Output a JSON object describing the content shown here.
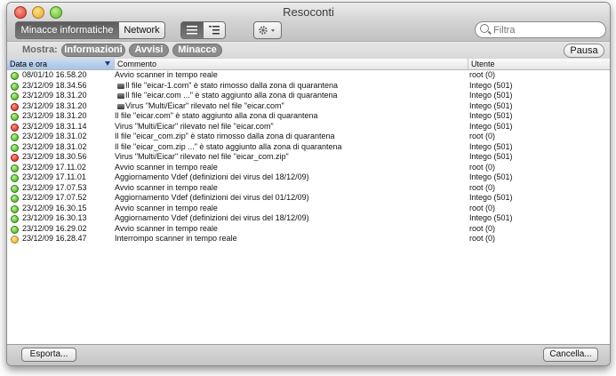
{
  "window": {
    "title": "Resoconti"
  },
  "tabs": [
    {
      "label": "Minacce informatiche",
      "active": true
    },
    {
      "label": "Network",
      "active": false
    }
  ],
  "view_toggle": {
    "selected": "list",
    "options": [
      "list-icon",
      "detail-list-icon"
    ]
  },
  "action_menu": {
    "icon": "gear-icon"
  },
  "search": {
    "placeholder": "Filtra",
    "value": ""
  },
  "filter_bar": {
    "label": "Mostra:",
    "filters": [
      "Informazioni",
      "Avvisi",
      "Minacce"
    ],
    "pause_label": "Pausa"
  },
  "table": {
    "columns": {
      "date": "Data e ora",
      "comment": "Commento",
      "user": "Utente"
    },
    "sort_column": "date",
    "rows": [
      {
        "status": "ok",
        "date": "08/01/10 16.58.20",
        "comment": "Avvio scanner in tempo reale",
        "sub": false,
        "user": "root (0)"
      },
      {
        "status": "ok",
        "date": "23/12/09 18.34.56",
        "comment": "Il file \"eicar-1.com\" è stato rimosso dalla zona di quarantena",
        "sub": true,
        "user": "Intego (501)"
      },
      {
        "status": "ok",
        "date": "23/12/09 18.31.20",
        "comment": "Il file \"eicar.com ...\" è stato aggiunto alla zona di quarantena",
        "sub": true,
        "user": "Intego (501)"
      },
      {
        "status": "alert",
        "date": "23/12/09 18.31.20",
        "comment": "Virus \"Multi/Eicar\" rilevato nel file \"eicar.com\"",
        "sub": true,
        "user": "Intego (501)"
      },
      {
        "status": "ok",
        "date": "23/12/09 18.31.20",
        "comment": "Il file \"eicar.com\" è stato aggiunto alla zona di quarantena",
        "sub": false,
        "user": "Intego (501)"
      },
      {
        "status": "alert",
        "date": "23/12/09 18.31.14",
        "comment": "Virus \"Multi/Eicar\" rilevato nel file \"eicar.com\"",
        "sub": false,
        "user": "Intego (501)"
      },
      {
        "status": "ok",
        "date": "23/12/09 18.31.02",
        "comment": "Il file \"eicar_com.zip\" è stato rimosso dalla zona di quarantena",
        "sub": false,
        "user": "root (0)"
      },
      {
        "status": "ok",
        "date": "23/12/09 18.31.02",
        "comment": "Il file \"eicar_com.zip ...\" è stato aggiunto alla zona di quarantena",
        "sub": false,
        "user": "Intego (501)"
      },
      {
        "status": "alert",
        "date": "23/12/09 18.30.56",
        "comment": "Virus \"Multi/Eicar\" rilevato nel file \"eicar_com.zip\"",
        "sub": false,
        "user": "Intego (501)"
      },
      {
        "status": "ok",
        "date": "23/12/09 17.11.02",
        "comment": "Avvio scanner in tempo reale",
        "sub": false,
        "user": "root (0)"
      },
      {
        "status": "ok",
        "date": "23/12/09 17.11.01",
        "comment": "Aggiornamento Vdef (definizioni dei virus del 18/12/09)",
        "sub": false,
        "user": "Intego (501)"
      },
      {
        "status": "ok",
        "date": "23/12/09 17.07.53",
        "comment": "Avvio scanner in tempo reale",
        "sub": false,
        "user": "root (0)"
      },
      {
        "status": "ok",
        "date": "23/12/09 17.07.52",
        "comment": "Aggiornamento Vdef (definizioni dei virus del 01/12/09)",
        "sub": false,
        "user": "Intego (501)"
      },
      {
        "status": "ok",
        "date": "23/12/09 16.30.15",
        "comment": "Avvio scanner in tempo reale",
        "sub": false,
        "user": "root (0)"
      },
      {
        "status": "ok",
        "date": "23/12/09 16.30.13",
        "comment": "Aggiornamento Vdef (definizioni dei virus del 18/12/09)",
        "sub": false,
        "user": "Intego (501)"
      },
      {
        "status": "ok",
        "date": "23/12/09 16.29.02",
        "comment": "Avvio scanner in tempo reale",
        "sub": false,
        "user": "root (0)"
      },
      {
        "status": "warn",
        "date": "23/12/09 16.28.47",
        "comment": "Interrompo scanner in tempo reale",
        "sub": false,
        "user": "root (0)"
      }
    ]
  },
  "buttons": {
    "export": "Esporta...",
    "cancel": "Cancella..."
  },
  "colors": {
    "ok": "#3aa613",
    "alert": "#d21d14",
    "warn": "#e8a916",
    "header_selected": "#a8c3e6"
  }
}
